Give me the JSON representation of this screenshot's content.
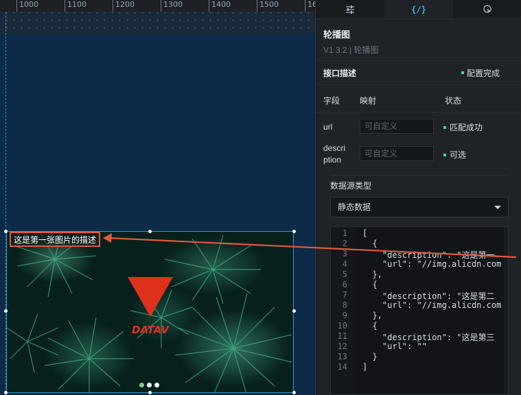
{
  "ruler": {
    "ticks": [
      "1000",
      "1100",
      "1200",
      "1300",
      "1400",
      "1500",
      "16"
    ]
  },
  "carousel": {
    "caption": "这是第一张图片的描述",
    "logo_text": "DATAV",
    "dots": [
      {
        "active": true
      },
      {
        "active": false
      },
      {
        "active": false
      }
    ]
  },
  "panel": {
    "tabs": [
      {
        "icon": "sliders-icon",
        "label": "",
        "active": false
      },
      {
        "icon": "code-braces-icon",
        "label": "{/}",
        "active": true
      },
      {
        "icon": "interaction-icon",
        "label": "",
        "active": false
      }
    ],
    "component_title": "轮播图",
    "component_version": "V1.3.2 | 轮播图",
    "api_section": {
      "title": "接口描述",
      "status": "配置完成"
    },
    "columns": {
      "field": "字段",
      "mapping": "映射",
      "status": "状态"
    },
    "fields": [
      {
        "name": "url",
        "placeholder": "可自定义",
        "status": "匹配成功"
      },
      {
        "name": "description",
        "name_line1": "descri",
        "name_line2": "ption",
        "placeholder": "可自定义",
        "status": "可选"
      }
    ],
    "datasource": {
      "label": "数据源类型",
      "selected": "静态数据"
    },
    "code_lines": [
      "[",
      "  {",
      "    \"description\": \"这是第一",
      "    \"url\": \"//img.alicdn.com",
      "  },",
      "  {",
      "    \"description\": \"这是第二",
      "    \"url\": \"//img.alicdn.com",
      "  },",
      "  {",
      "    \"description\": \"这是第三",
      "    \"url\": \"\"",
      "  }",
      "]"
    ],
    "line_numbers": [
      "1",
      "2",
      "3",
      "4",
      "5",
      "6",
      "7",
      "8",
      "9",
      "10",
      "11",
      "12",
      "13",
      "14"
    ]
  },
  "colors": {
    "accent": "#3fb6e6",
    "highlight": "#e25a3c",
    "success": "#3ddc97"
  }
}
